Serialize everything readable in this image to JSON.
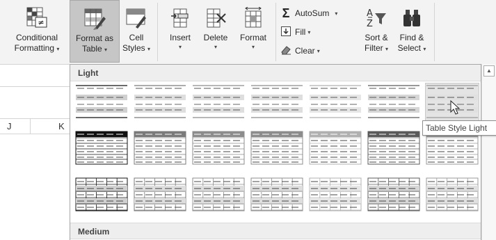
{
  "ribbon": {
    "conditional_formatting": {
      "line1": "Conditional",
      "line2": "Formatting",
      "arrow": "▾"
    },
    "format_as_table": {
      "line1": "Format as",
      "line2": "Table",
      "arrow": "▾"
    },
    "cell_styles": {
      "line1": "Cell",
      "line2": "Styles",
      "arrow": "▾"
    },
    "insert": {
      "label": "Insert",
      "arrow": "▾"
    },
    "delete": {
      "label": "Delete",
      "arrow": "▾"
    },
    "format": {
      "label": "Format",
      "arrow": "▾"
    },
    "autosum": {
      "label": "AutoSum",
      "arrow": "▾"
    },
    "fill": {
      "label": "Fill",
      "arrow": "▾"
    },
    "clear": {
      "label": "Clear",
      "arrow": "▾"
    },
    "sort_filter": {
      "line1": "Sort &",
      "line2": "Filter",
      "arrow": "▾"
    },
    "find_select": {
      "line1": "Find &",
      "line2": "Select",
      "arrow": "▾"
    }
  },
  "sheet": {
    "col_j": "J",
    "col_k": "K"
  },
  "gallery": {
    "section_light": "Light",
    "section_medium": "Medium",
    "hovered_style": "Table Style Light"
  },
  "scrollbar": {
    "up_arrow": "▲"
  },
  "colors": {
    "ribbon_bg": "#f3f3f3",
    "active_button": "#c6c6c6",
    "panel_border": "#a6a6a6",
    "section_header": "#eeeeee"
  }
}
